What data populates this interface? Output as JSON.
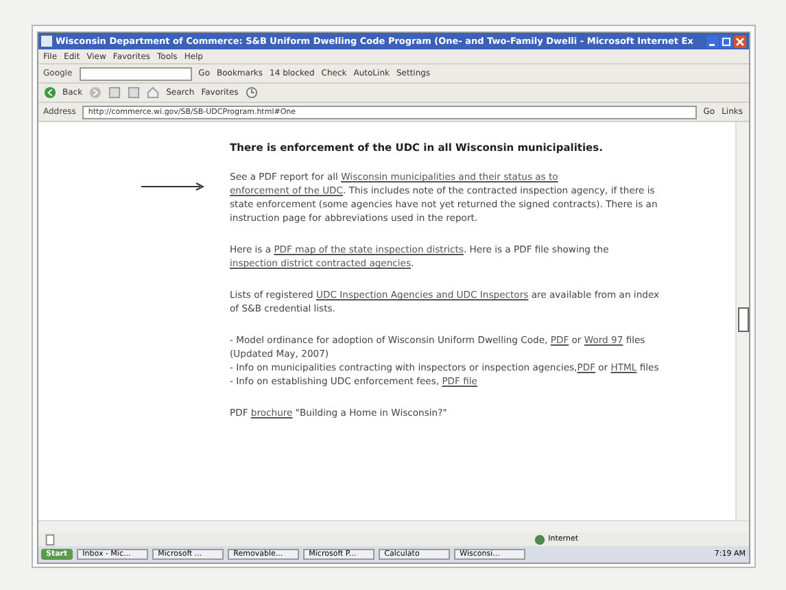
{
  "window": {
    "title": "Wisconsin Department of Commerce: S&B Uniform Dwelling Code Program (One- and Two-Family Dwelli - Microsoft Internet Ex"
  },
  "menu": [
    "File",
    "Edit",
    "View",
    "Favorites",
    "Tools",
    "Help"
  ],
  "google_toolbar": {
    "label": "Google",
    "items": [
      "Go",
      "Bookmarks",
      "14 blocked",
      "Check",
      "AutoLink",
      "Settings"
    ]
  },
  "nav_toolbar": [
    "Back",
    "Search",
    "Favorites"
  ],
  "address_bar": {
    "label": "Address",
    "value": "http://commerce.wi.gov/SB/SB-UDCProgram.html#One",
    "go": "Go",
    "links": "Links"
  },
  "content": {
    "heading": "There is enforcement of the UDC in all Wisconsin municipalities.",
    "paragraphs": [
      [
        {
          "kind": "text",
          "text": "See a PDF report for all "
        },
        {
          "kind": "link",
          "text": "Wisconsin municipalities and their status as to"
        },
        {
          "kind": "break"
        },
        {
          "kind": "link",
          "text": "enforcement of the UDC"
        },
        {
          "kind": "text",
          "text": ".  This includes note of the contracted inspection agency, if there is state enforcement (some agencies have not yet returned the signed contracts).  There is an instruction page for abbreviations used in the report."
        }
      ],
      [
        {
          "kind": "text",
          "text": "Here is a "
        },
        {
          "kind": "link",
          "text": "PDF map of the state inspection districts"
        },
        {
          "kind": "text",
          "text": ".  Here is a PDF file showing the "
        },
        {
          "kind": "link",
          "text": "inspection district contracted agencies"
        },
        {
          "kind": "text",
          "text": "."
        }
      ],
      [
        {
          "kind": "text",
          "text": "Lists of registered "
        },
        {
          "kind": "link",
          "text": "UDC Inspection Agencies and UDC Inspectors"
        },
        {
          "kind": "text",
          "text": " are available from an index of S&B credential lists."
        }
      ],
      [
        {
          "kind": "text",
          "text": "- Model ordinance for adoption of Wisconsin Uniform Dwelling Code, "
        },
        {
          "kind": "link",
          "text": "PDF"
        },
        {
          "kind": "text",
          "text": " or "
        },
        {
          "kind": "link",
          "text": "Word 97"
        },
        {
          "kind": "text",
          "text": " files (Updated May, 2007)"
        },
        {
          "kind": "break"
        },
        {
          "kind": "text",
          "text": "- Info on municipalities contracting with inspectors or inspection agencies,"
        },
        {
          "kind": "link",
          "text": "PDF"
        },
        {
          "kind": "text",
          "text": " or "
        },
        {
          "kind": "link",
          "text": "HTML"
        },
        {
          "kind": "text",
          "text": " files"
        },
        {
          "kind": "break"
        },
        {
          "kind": "text",
          "text": "- Info on establishing UDC enforcement fees, "
        },
        {
          "kind": "link",
          "text": "PDF file"
        }
      ],
      [
        {
          "kind": "text",
          "text": "PDF "
        },
        {
          "kind": "link",
          "text": "brochure"
        },
        {
          "kind": "text",
          "text": " \"Building a Home in Wisconsin?\""
        }
      ]
    ]
  },
  "status_bar": {
    "zone": "Internet"
  },
  "taskbar": {
    "start": "Start",
    "tasks": [
      "Inbox - Mic...",
      "Microsoft ...",
      "Removable...",
      "Microsoft P...",
      "Calculato",
      "Wisconsi..."
    ],
    "clock": "7:19 AM"
  }
}
